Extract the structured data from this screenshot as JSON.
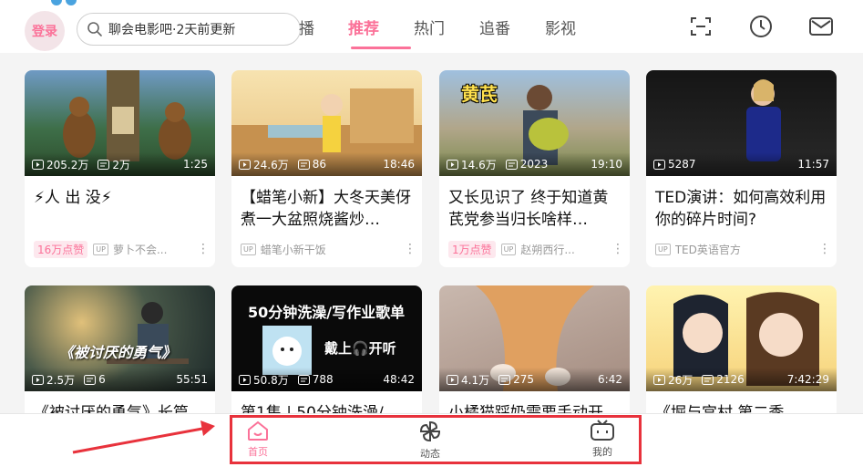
{
  "header": {
    "login_label": "登录",
    "search_placeholder": "聊会电影吧·2天前更新",
    "tabs": [
      {
        "label": "播",
        "active": false
      },
      {
        "label": "推荐",
        "active": true
      },
      {
        "label": "热门",
        "active": false
      },
      {
        "label": "追番",
        "active": false
      },
      {
        "label": "影视",
        "active": false
      }
    ],
    "icons": [
      "scan-icon",
      "history-clock-icon",
      "message-envelope-icon"
    ]
  },
  "cards": [
    {
      "views": "205.2万",
      "comments": "2万",
      "duration": "1:25",
      "title": "⚡人 出 没⚡",
      "badge": "16万点赞",
      "owner": "萝卜不会..."
    },
    {
      "views": "24.6万",
      "comments": "86",
      "duration": "18:46",
      "title": "【蜡笔小新】大冬天美伢煮一大盆照烧酱炒…",
      "badge": "",
      "owner": "蜡笔小新干饭"
    },
    {
      "views": "14.6万",
      "comments": "2023",
      "duration": "19:10",
      "overlay": "黄芪",
      "title": "又长见识了 终于知道黄芪党参当归长啥样…",
      "badge": "1万点赞",
      "owner": "赵朔西行..."
    },
    {
      "views": "5287",
      "comments": "",
      "duration": "11:57",
      "title": "TED演讲：如何高效利用你的碎片时间?",
      "badge": "",
      "owner": "TED英语官方"
    },
    {
      "views": "2.5万",
      "comments": "6",
      "duration": "55:51",
      "overlay": "《被讨厌的勇气》",
      "title": "《被讨厌的勇气》长篇",
      "badge": "",
      "owner": ""
    },
    {
      "views": "50.8万",
      "comments": "788",
      "duration": "48:42",
      "overlay": "50分钟洗澡/写作业歌单",
      "overlay2": "戴上🎧开听",
      "title": "第1集 | 50分钟洗澡/",
      "badge": "",
      "owner": ""
    },
    {
      "views": "4.1万",
      "comments": "275",
      "duration": "6:42",
      "title": "小橘猫踩奶需要手动开",
      "badge": "",
      "owner": ""
    },
    {
      "views": "26万",
      "comments": "2126",
      "duration": "7:42:29",
      "title": "《堀与宫村 第二季",
      "badge": "",
      "owner": ""
    }
  ],
  "bottom_nav": [
    {
      "label": "首页",
      "icon": "home-icon",
      "active": true
    },
    {
      "label": "动态",
      "icon": "pinwheel-icon",
      "active": false
    },
    {
      "label": "我的",
      "icon": "tv-face-icon",
      "active": false
    }
  ],
  "colors": {
    "accent": "#fb7299",
    "annotation": "#e8323c"
  }
}
